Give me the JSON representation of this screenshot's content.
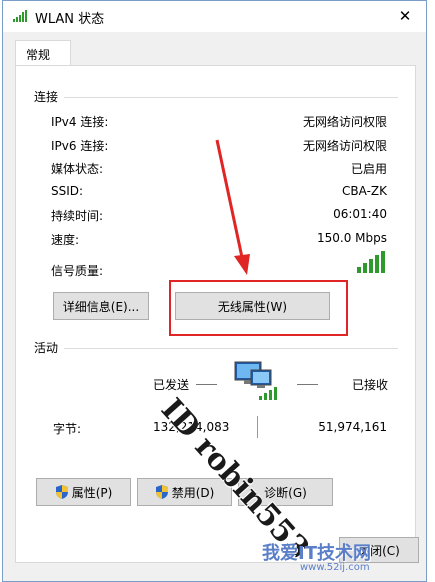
{
  "window": {
    "title": "WLAN 状态",
    "close_glyph": "✕"
  },
  "tabs": [
    {
      "label": "常规"
    }
  ],
  "connection": {
    "title": "连接",
    "rows": [
      {
        "label": "IPv4 连接:",
        "value": "无网络访问权限"
      },
      {
        "label": "IPv6 连接:",
        "value": "无网络访问权限"
      },
      {
        "label": "媒体状态:",
        "value": "已启用"
      },
      {
        "label": "SSID:",
        "value": "CBA-ZK"
      },
      {
        "label": "持续时间:",
        "value": "06:01:40"
      },
      {
        "label": "速度:",
        "value": "150.0 Mbps"
      },
      {
        "label": "信号质量:",
        "value": ""
      }
    ],
    "signal_bars": 5,
    "details_button": "详细信息(E)...",
    "wireless_props_button": "无线属性(W)"
  },
  "activity": {
    "title": "活动",
    "sent_label": "已发送",
    "received_label": "已接收",
    "bytes_label": "字节:",
    "bytes_sent": "132,214,083",
    "bytes_received": "51,974,161",
    "network_icon": "network-computers-icon"
  },
  "buttons": {
    "properties": "属性(P)",
    "disable": "禁用(D)",
    "diagnose": "诊断(G)",
    "close": "关闭(C)"
  },
  "watermark": {
    "text": "ID robin553",
    "site": "我爱IT技术网",
    "site_url": "www.52ij.com"
  },
  "colors": {
    "accent": "#1a5fb4",
    "highlight": "#e02525",
    "signal": "#2e9a2e",
    "arrow": "#e02525"
  }
}
